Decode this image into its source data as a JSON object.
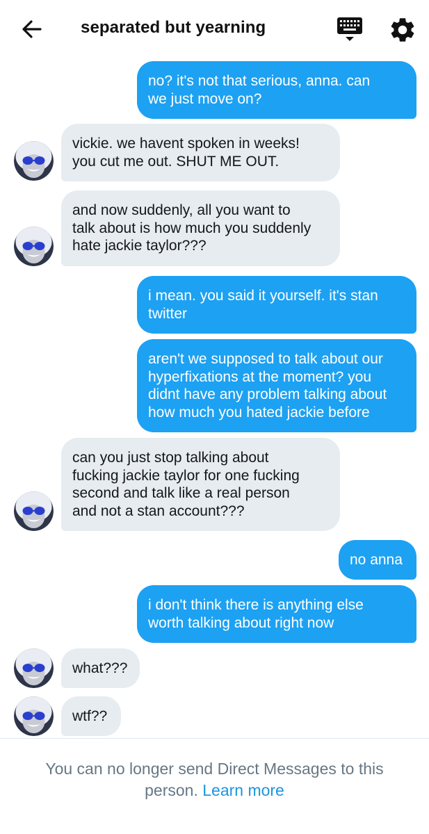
{
  "header": {
    "title": "separated but yearning",
    "back_icon": "arrow-left-icon",
    "keyboard_icon": "keyboard-icon",
    "settings_icon": "gear-icon"
  },
  "colors": {
    "outgoing_bubble": "#1da1f2",
    "incoming_bubble": "#e6ecf0",
    "footer_text": "#657786",
    "link": "#1b95e0"
  },
  "messages": [
    {
      "direction": "outgoing",
      "text": "no? it's not that serious, anna. can\nwe just move on?"
    },
    {
      "direction": "incoming",
      "text": "vickie. we havent spoken in weeks!\nyou cut me out. SHUT ME OUT."
    },
    {
      "direction": "incoming",
      "text": "and now suddenly, all you want to\ntalk about is how much you suddenly\nhate jackie taylor???"
    },
    {
      "direction": "outgoing",
      "text": "i mean. you said it yourself. it's stan\ntwitter"
    },
    {
      "direction": "outgoing",
      "text": "aren't we supposed to talk about our\nhyperfixations at the moment? you\ndidnt have any problem talking about\nhow much you hated jackie before"
    },
    {
      "direction": "incoming",
      "text": "can you just stop talking about\nfucking jackie taylor for one fucking\nsecond and talk like a real person\nand not a stan account???"
    },
    {
      "direction": "outgoing",
      "text": "no anna"
    },
    {
      "direction": "outgoing",
      "text": "i don't think there is anything else\nworth talking about right now"
    },
    {
      "direction": "incoming",
      "text": "what???"
    },
    {
      "direction": "incoming",
      "text": "wtf??"
    }
  ],
  "footer": {
    "notice_line1": "You can no longer send Direct Messages to this",
    "notice_line2": "person.",
    "learn_more": "Learn more"
  }
}
